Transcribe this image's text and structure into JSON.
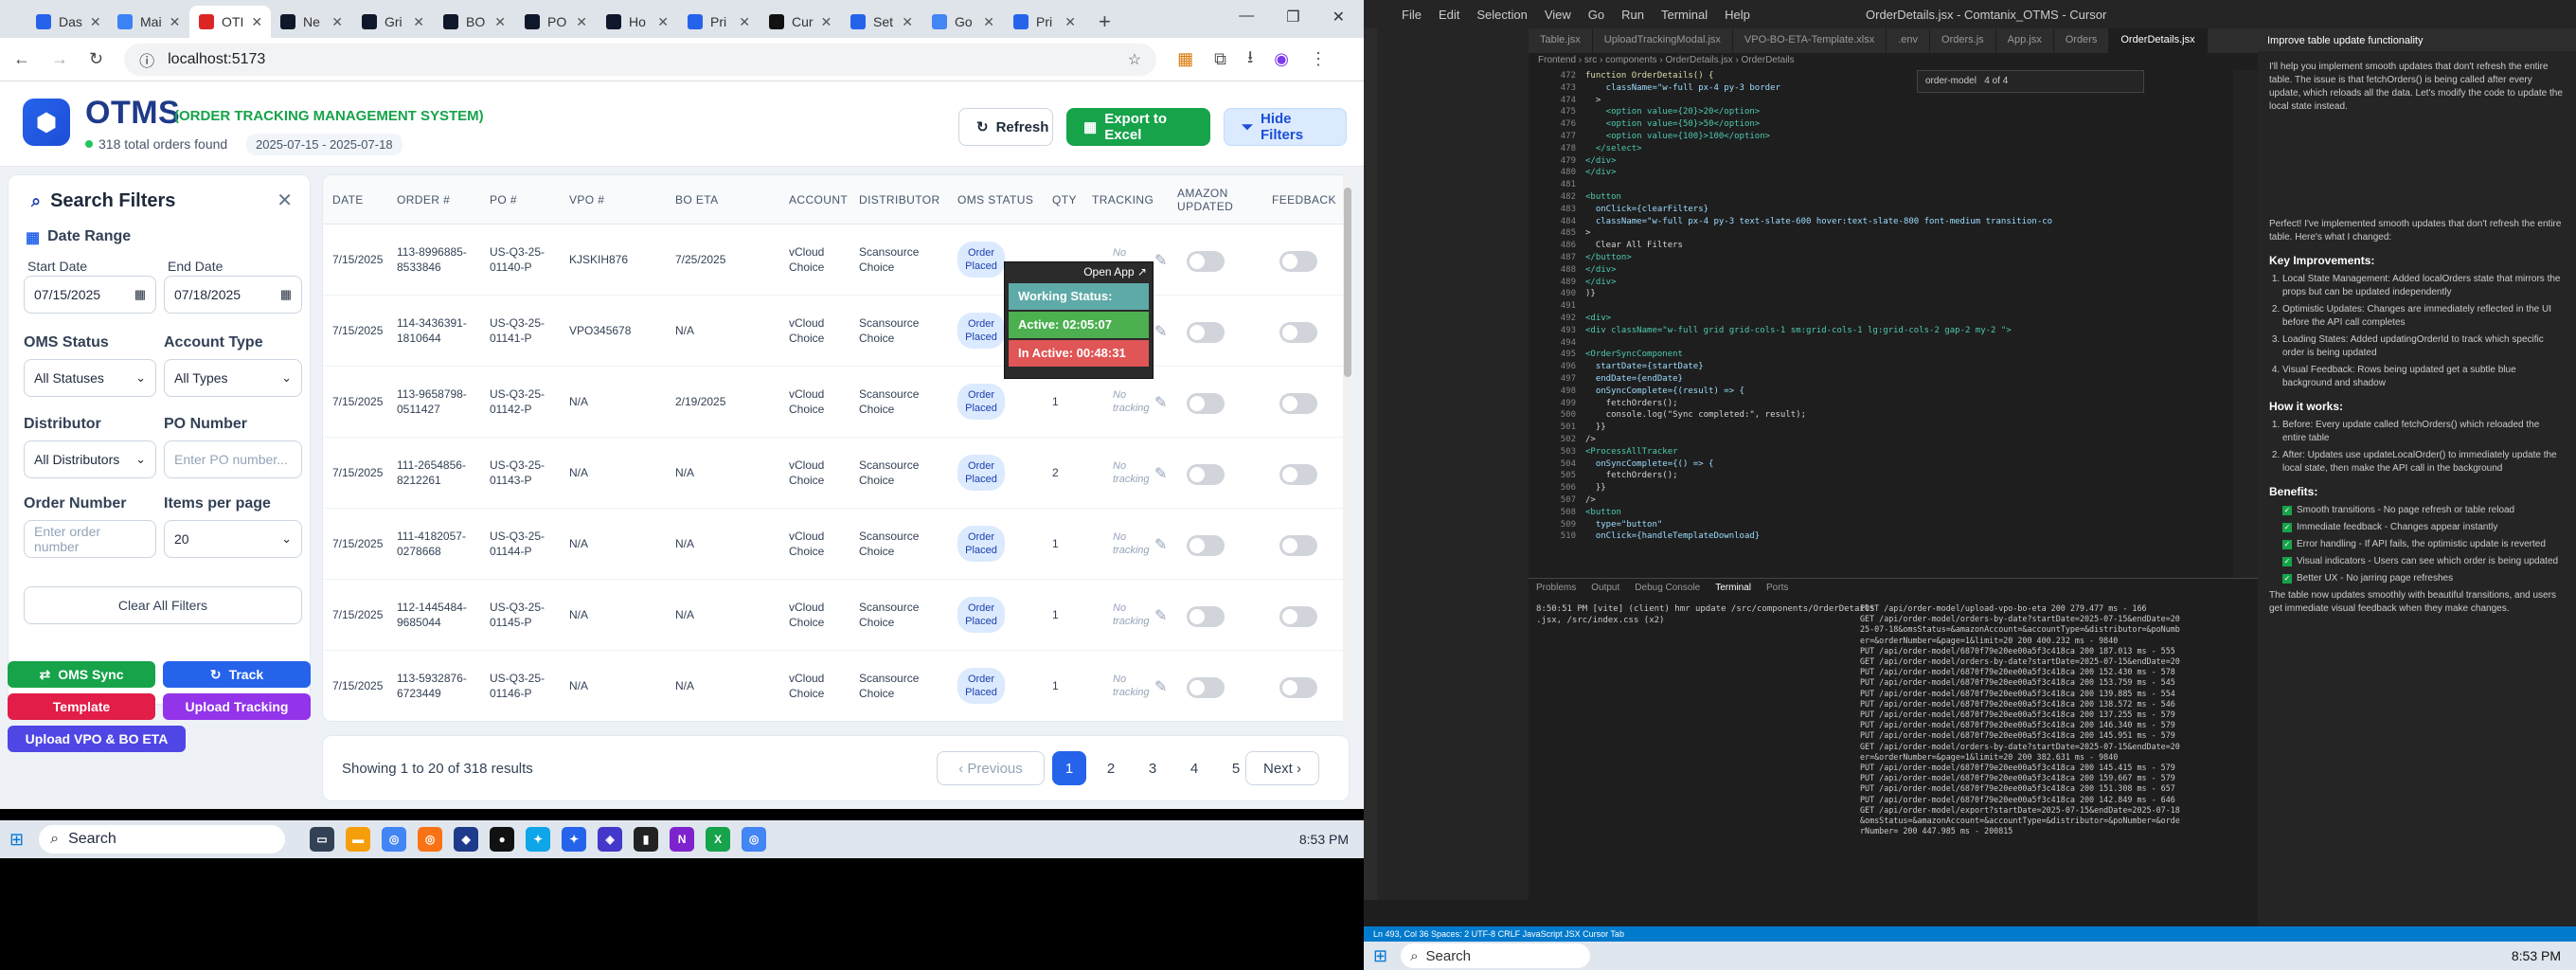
{
  "browser": {
    "tabs": [
      "Das",
      "Mai",
      "OTI",
      "Ne",
      "Gri",
      "BO",
      "PO",
      "Ho",
      "Pri",
      "Cur",
      "Set",
      "Go",
      "Pri"
    ],
    "active_tab": 2,
    "url": "localhost:5173"
  },
  "app": {
    "title": "OTMS",
    "subtitle": "(ORDER TRACKING MANAGEMENT SYSTEM)",
    "orders_found": "318 total orders found",
    "date_range": "2025-07-15 - 2025-07-18",
    "refresh_label": "Refresh",
    "export_label": "Export to Excel",
    "hide_filters_label": "Hide Filters"
  },
  "filters": {
    "title": "Search Filters",
    "date_range_label": "Date Range",
    "start_date_label": "Start Date",
    "start_date": "07/15/2025",
    "end_date_label": "End Date",
    "end_date": "07/18/2025",
    "oms_status_label": "OMS Status",
    "oms_status": "All Statuses",
    "account_type_label": "Account Type",
    "account_type": "All Types",
    "distributor_label": "Distributor",
    "distributor": "All Distributors",
    "po_number_label": "PO Number",
    "po_placeholder": "Enter PO number...",
    "order_number_label": "Order Number",
    "order_placeholder": "Enter order number",
    "items_per_page_label": "Items per page",
    "items_per_page": "20",
    "clear_label": "Clear All Filters"
  },
  "actions": {
    "oms_sync": "OMS Sync",
    "track": "Track",
    "template": "Template",
    "upload_tracking": "Upload Tracking",
    "upload_vpo": "Upload VPO & BO ETA"
  },
  "table": {
    "headers": [
      "DATE",
      "ORDER #",
      "PO #",
      "VPO #",
      "BO ETA",
      "ACCOUNT",
      "DISTRIBUTOR",
      "OMS STATUS",
      "QTY",
      "TRACKING",
      "AMAZON UPDATED",
      "FEEDBACK"
    ],
    "rows": [
      {
        "date": "7/15/2025",
        "order": "113-8996885-8533846",
        "po": "US-Q3-25-01140-P",
        "vpo": "KJSKIH876",
        "boeta": "7/25/2025",
        "account": "vCloud Choice",
        "distributor": "Scansource Choice",
        "status": "Order Placed",
        "qty": "",
        "tracking": "No tracking"
      },
      {
        "date": "7/15/2025",
        "order": "114-3436391-1810644",
        "po": "US-Q3-25-01141-P",
        "vpo": "VPO345678",
        "boeta": "N/A",
        "account": "vCloud Choice",
        "distributor": "Scansource Choice",
        "status": "Order Placed",
        "qty": "1",
        "tracking": "No tracking"
      },
      {
        "date": "7/15/2025",
        "order": "113-9658798-0511427",
        "po": "US-Q3-25-01142-P",
        "vpo": "N/A",
        "boeta": "2/19/2025",
        "account": "vCloud Choice",
        "distributor": "Scansource Choice",
        "status": "Order Placed",
        "qty": "1",
        "tracking": "No tracking"
      },
      {
        "date": "7/15/2025",
        "order": "111-2654856-8212261",
        "po": "US-Q3-25-01143-P",
        "vpo": "N/A",
        "boeta": "N/A",
        "account": "vCloud Choice",
        "distributor": "Scansource Choice",
        "status": "Order Placed",
        "qty": "2",
        "tracking": "No tracking"
      },
      {
        "date": "7/15/2025",
        "order": "111-4182057-0278668",
        "po": "US-Q3-25-01144-P",
        "vpo": "N/A",
        "boeta": "N/A",
        "account": "vCloud Choice",
        "distributor": "Scansource Choice",
        "status": "Order Placed",
        "qty": "1",
        "tracking": "No tracking"
      },
      {
        "date": "7/15/2025",
        "order": "112-1445484-9685044",
        "po": "US-Q3-25-01145-P",
        "vpo": "N/A",
        "boeta": "N/A",
        "account": "vCloud Choice",
        "distributor": "Scansource Choice",
        "status": "Order Placed",
        "qty": "1",
        "tracking": "No tracking"
      },
      {
        "date": "7/15/2025",
        "order": "113-5932876-6723449",
        "po": "US-Q3-25-01146-P",
        "vpo": "N/A",
        "boeta": "N/A",
        "account": "vCloud Choice",
        "distributor": "Scansource Choice",
        "status": "Order Placed",
        "qty": "1",
        "tracking": "No tracking"
      }
    ]
  },
  "tracker": {
    "open_app": "Open App ↗",
    "working_status": "Working Status: Active",
    "active": "Active: 02:05:07",
    "inactive": "In Active: 00:48:31"
  },
  "pagination": {
    "info": "Showing 1 to 20 of 318 results",
    "previous": "‹ Previous",
    "pages": [
      "1",
      "2",
      "3",
      "4",
      "5"
    ],
    "next": "Next ›"
  },
  "taskbar": {
    "search": "Search",
    "time_left": "8:53 PM",
    "time_right": "8:53 PM"
  },
  "vscode": {
    "title": "OrderDetails.jsx - Comtanix_OTMS - Cursor",
    "menu": [
      "File",
      "Edit",
      "Selection",
      "View",
      "Go",
      "Run",
      "Terminal",
      "Help"
    ],
    "tabs": [
      "Table.jsx",
      "UploadTrackingModal.jsx",
      "VPO-BO-ETA-Template.xlsx",
      ".env",
      "Orders.js",
      "App.jsx",
      "Orders",
      "OrderDetails.jsx"
    ],
    "breadcrumbs": "Frontend › src › components › OrderDetails.jsx › OrderDetails",
    "find_text": "order-model",
    "find_count": "4 of 4",
    "code_lines": [
      [
        "472",
        "function OrderDetails() {"
      ],
      [
        "473",
        "    className=\"w-full px-4 py-3 border"
      ],
      [
        "474",
        "  >"
      ],
      [
        "475",
        "    <option value={20}>20</option>"
      ],
      [
        "476",
        "    <option value={50}>50</option>"
      ],
      [
        "477",
        "    <option value={100}>100</option>"
      ],
      [
        "478",
        "  </select>"
      ],
      [
        "479",
        "</div>"
      ],
      [
        "480",
        "</div>"
      ],
      [
        "481",
        ""
      ],
      [
        "482",
        "<button"
      ],
      [
        "483",
        "  onClick={clearFilters}"
      ],
      [
        "484",
        "  className=\"w-full px-4 py-3 text-slate-600 hover:text-slate-800 font-medium transition-co"
      ],
      [
        "485",
        ">"
      ],
      [
        "486",
        "  Clear All Filters"
      ],
      [
        "487",
        "</button>"
      ],
      [
        "488",
        "</div>"
      ],
      [
        "489",
        "</div>"
      ],
      [
        "490",
        ")}"
      ],
      [
        "491",
        ""
      ],
      [
        "492",
        "<div>"
      ],
      [
        "493",
        "<div className=\"w-full grid grid-cols-1 sm:grid-cols-1 lg:grid-cols-2 gap-2 my-2 \">"
      ],
      [
        "494",
        ""
      ],
      [
        "495",
        "<OrderSyncComponent"
      ],
      [
        "496",
        "  startDate={startDate}"
      ],
      [
        "497",
        "  endDate={endDate}"
      ],
      [
        "498",
        "  onSyncComplete={(result) => {"
      ],
      [
        "499",
        "    fetchOrders();"
      ],
      [
        "500",
        "    console.log(\"Sync completed:\", result);"
      ],
      [
        "501",
        "  }}"
      ],
      [
        "502",
        "/>"
      ],
      [
        "503",
        "<ProcessAllTracker"
      ],
      [
        "504",
        "  onSyncComplete={() => {"
      ],
      [
        "505",
        "    fetchOrders();"
      ],
      [
        "506",
        "  }}"
      ],
      [
        "507",
        "/>"
      ],
      [
        "508",
        "<button"
      ],
      [
        "509",
        "  type=\"button\""
      ],
      [
        "510",
        "  onClick={handleTemplateDownload}"
      ]
    ],
    "terminal_tabs": [
      "Problems",
      "Output",
      "Debug Console",
      "Terminal",
      "Ports"
    ],
    "terminal_left": [
      "8:50:51 PM [vite] (client) hmr update /src/components/OrderDetails",
      ".jsx, /src/index.css (x2)"
    ],
    "terminal_right": [
      "POST /api/order-model/upload-vpo-bo-eta 200 279.477 ms - 166",
      "GET /api/order-model/orders-by-date?startDate=2025-07-15&endDate=20",
      "25-07-18&omsStatus=&amazonAccount=&accountType=&distributor=&poNumb",
      "er=&orderNumber=&page=1&limit=20 200 400.232 ms - 9840",
      "PUT /api/order-model/6870f79e20ee00a5f3c418ca 200 187.013 ms - 555",
      "GET /api/order-model/orders-by-date?startDate=2025-07-15&endDate=20",
      "PUT /api/order-model/6870f79e20ee00a5f3c418ca 200 152.430 ms - 578",
      "PUT /api/order-model/6870f79e20ee00a5f3c418ca 200 153.759 ms - 545",
      "PUT /api/order-model/6870f79e20ee00a5f3c418ca 200 139.885 ms - 554",
      "PUT /api/order-model/6870f79e20ee00a5f3c418ca 200 138.572 ms - 546",
      "PUT /api/order-model/6870f79e20ee00a5f3c418ca 200 137.255 ms - 579",
      "PUT /api/order-model/6870f79e20ee00a5f3c418ca 200 146.340 ms - 579",
      "PUT /api/order-model/6870f79e20ee00a5f3c418ca 200 145.951 ms - 579",
      "GET /api/order-model/orders-by-date?startDate=2025-07-15&endDate=20",
      "er=&orderNumber=&page=1&limit=20 200 382.631 ms - 9840",
      "PUT /api/order-model/6870f79e20ee00a5f3c418ca 200 145.415 ms - 579",
      "PUT /api/order-model/6870f79e20ee00a5f3c418ca 200 159.667 ms - 579",
      "PUT /api/order-model/6870f79e20ee00a5f3c418ca 200 151.308 ms - 657",
      "PUT /api/order-model/6870f79e20ee00a5f3c418ca 200 142.849 ms - 646",
      "GET /api/order-model/export?startDate=2025-07-15&endDate=2025-07-18",
      "&omsStatus=&amazonAccount=&accountType=&distributor=&poNumber=&orde",
      "rNumber= 200 447.985 ms - 200815"
    ],
    "chat_title": "Improve table update functionality",
    "chat_intro": "I'll help you implement smooth updates that don't refresh the entire table. The issue is that fetchOrders() is being called after every update, which reloads all the data. Let's modify the code to update the local state instead.",
    "chat_done": "Perfect! I've implemented smooth updates that don't refresh the entire table. Here's what I changed:",
    "chat_h1": "Key Improvements:",
    "chat_points": [
      "Local State Management: Added localOrders state that mirrors the props but can be updated independently",
      "Optimistic Updates: Changes are immediately reflected in the UI before the API call completes",
      "Loading States: Added updatingOrderId to track which specific order is being updated",
      "Visual Feedback: Rows being updated get a subtle blue background and shadow"
    ],
    "chat_h2": "How it works:",
    "chat_how": [
      "Before: Every update called fetchOrders() which reloaded the entire table",
      "After: Updates use updateLocalOrder() to immediately update the local state, then make the API call in the background"
    ],
    "chat_h3": "Benefits:",
    "chat_benefits": [
      "Smooth transitions - No page refresh or table reload",
      "Immediate feedback - Changes appear instantly",
      "Error handling - If API fails, the optimistic update is reverted",
      "Visual indicators - Users can see which order is being updated",
      "Better UX - No jarring page refreshes"
    ],
    "chat_outro": "The table now updates smoothly with beautiful transitions, and users get immediate visual feedback when they make changes.",
    "status": "Ln 493, Col 36   Spaces: 2   UTF-8   CRLF   JavaScript JSX   Cursor Tab"
  }
}
